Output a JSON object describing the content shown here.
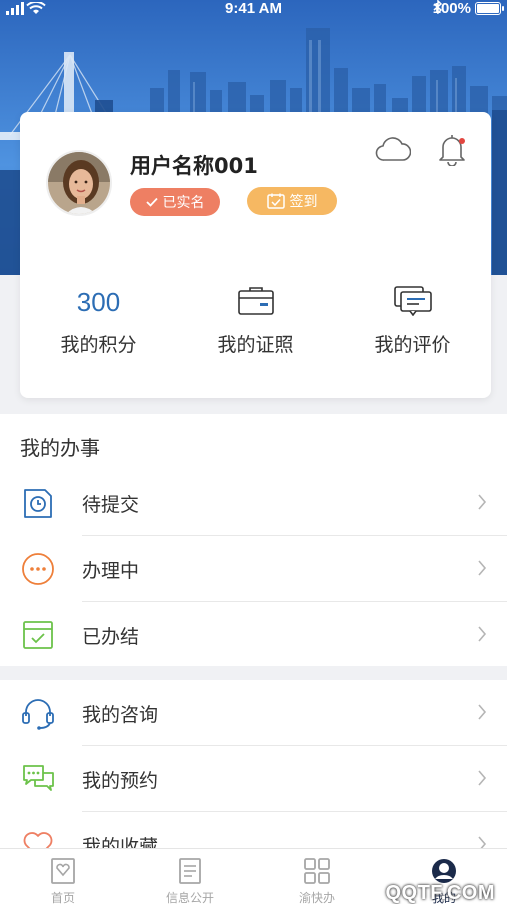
{
  "status_bar": {
    "time": "9:41 AM",
    "battery": "100%",
    "battery_level": 1.0
  },
  "profile": {
    "username": "用户名称001",
    "verified_label": "已实名",
    "checkin_label": "签到",
    "icons": [
      "cloud-icon",
      "bell-icon"
    ]
  },
  "stats": [
    {
      "value": "300",
      "label": "我的积分"
    },
    {
      "icon": "license-card-icon",
      "label": "我的证照"
    },
    {
      "icon": "review-message-icon",
      "label": "我的评价"
    }
  ],
  "affairs": {
    "title": "我的办事",
    "items": [
      {
        "label": "待提交",
        "icon": "clock-document-icon"
      },
      {
        "label": "办理中",
        "icon": "ellipsis-circle-icon"
      },
      {
        "label": "已办结",
        "icon": "check-calendar-icon"
      }
    ]
  },
  "services": {
    "items": [
      {
        "label": "我的咨询",
        "icon": "headset-icon"
      },
      {
        "label": "我的预约",
        "icon": "chat-bubbles-icon"
      },
      {
        "label": "我的收藏",
        "icon": "heart-icon"
      }
    ]
  },
  "tabbar": {
    "tabs": [
      {
        "label": "首页",
        "icon": "home-icon"
      },
      {
        "label": "信息公开",
        "icon": "document-icon"
      },
      {
        "label": "渝快办",
        "icon": "grid-icon"
      },
      {
        "label": "我的",
        "icon": "user-avatar-icon"
      }
    ],
    "active_index": 3
  },
  "watermark": "QQTF.COM",
  "colors": {
    "primary_blue": "#2c6db4",
    "verified_badge": "#ee7f63",
    "checkin_badge": "#f6b862",
    "green_icon": "#6cc24a",
    "orange_icon": "#ee7f3a"
  }
}
